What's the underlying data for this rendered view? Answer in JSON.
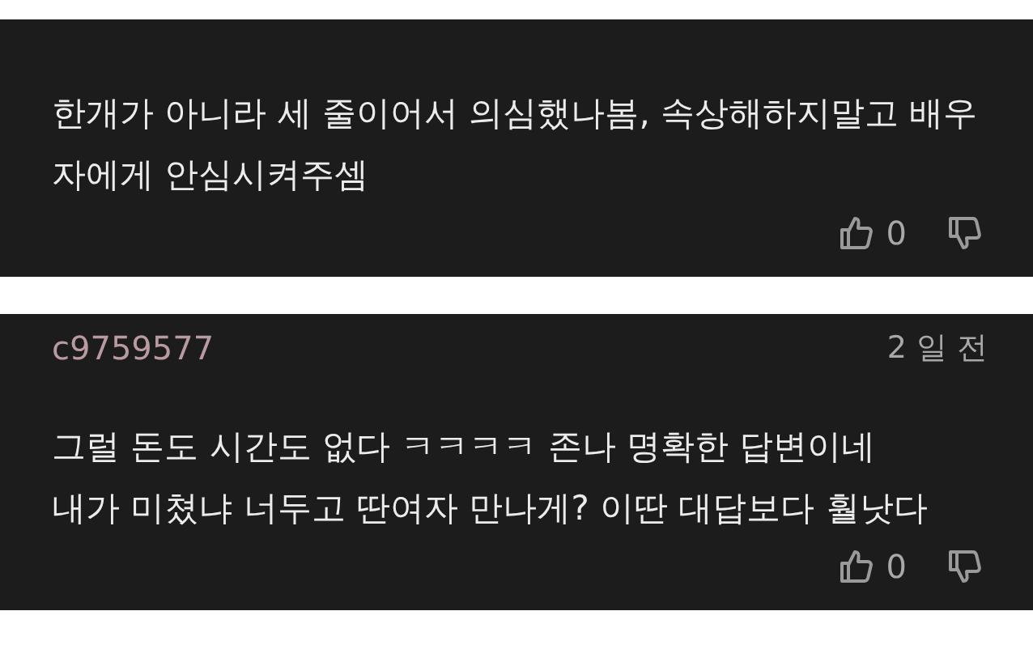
{
  "comments": [
    {
      "lines": [
        "한개가 아니라 세 줄이어서 의심했나봄, 속상해하지말고 배우자에게 안심시켜주셈"
      ],
      "likes": "0"
    },
    {
      "author": {
        "name": "c9759577",
        "color": "#b89aa0",
        "time": "2 일 전"
      },
      "lines": [
        "그럴 돈도 시간도 없다 ㅋㅋㅋㅋ 존나 명확한 답변이네",
        "내가 미쳤냐 너두고 딴여자 만나게? 이딴 대답보다 훨낫다"
      ],
      "likes": "0"
    }
  ]
}
